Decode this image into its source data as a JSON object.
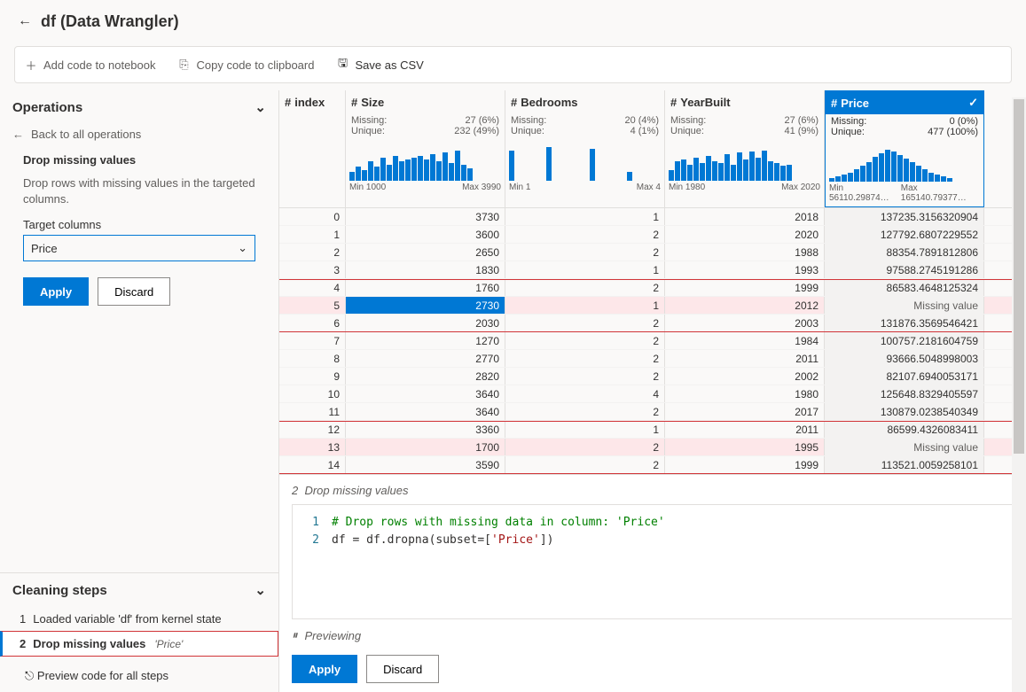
{
  "header": {
    "title": "df (Data Wrangler)"
  },
  "toolbar": {
    "add_code": "Add code to notebook",
    "copy_code": "Copy code to clipboard",
    "save_csv": "Save as CSV"
  },
  "operations": {
    "heading": "Operations",
    "back": "Back to all operations",
    "title": "Drop missing values",
    "desc": "Drop rows with missing values in the targeted columns.",
    "target_label": "Target columns",
    "target_value": "Price",
    "apply": "Apply",
    "discard": "Discard"
  },
  "steps": {
    "heading": "Cleaning steps",
    "items": [
      {
        "n": "1",
        "label": "Loaded variable 'df' from kernel state",
        "sub": ""
      },
      {
        "n": "2",
        "label": "Drop missing values",
        "sub": "'Price'"
      }
    ],
    "preview_all": "Preview code for all steps"
  },
  "columns": [
    {
      "key": "index",
      "label": "index",
      "missing": "",
      "unique": "",
      "min": "",
      "max": "",
      "bars": []
    },
    {
      "key": "size",
      "label": "Size",
      "missing": "27 (6%)",
      "unique": "232 (49%)",
      "min": "Min 1000",
      "max": "Max 3990",
      "bars": [
        10,
        16,
        12,
        22,
        16,
        26,
        18,
        28,
        22,
        24,
        26,
        28,
        24,
        30,
        22,
        32,
        20,
        34,
        18,
        14
      ]
    },
    {
      "key": "bed",
      "label": "Bedrooms",
      "missing": "20 (4%)",
      "unique": "4 (1%)",
      "min": "Min 1",
      "max": "Max 4",
      "bars": [
        34,
        0,
        0,
        0,
        0,
        0,
        38,
        0,
        0,
        0,
        0,
        0,
        0,
        36,
        0,
        0,
        0,
        0,
        0,
        10
      ]
    },
    {
      "key": "year",
      "label": "YearBuilt",
      "missing": "27 (6%)",
      "unique": "41 (9%)",
      "min": "Min 1980",
      "max": "Max 2020",
      "bars": [
        12,
        22,
        24,
        18,
        26,
        20,
        28,
        22,
        20,
        30,
        18,
        32,
        24,
        33,
        26,
        34,
        22,
        20,
        17,
        18
      ]
    },
    {
      "key": "price",
      "label": "Price",
      "missing": "0 (0%)",
      "unique": "477 (100%)",
      "min": "Min 56110.29874…",
      "max": "Max 165140.79377…",
      "bars": [
        4,
        6,
        8,
        10,
        14,
        18,
        22,
        28,
        32,
        36,
        34,
        30,
        26,
        22,
        18,
        14,
        10,
        8,
        6,
        4
      ]
    }
  ],
  "missing_l": "Missing:",
  "unique_l": "Unique:",
  "rows": [
    {
      "i": 0,
      "size": 3730,
      "bed": 1,
      "year": 2018,
      "price": "137235.3156320904",
      "hl": ""
    },
    {
      "i": 1,
      "size": 3600,
      "bed": 2,
      "year": 2020,
      "price": "127792.6807229552",
      "hl": ""
    },
    {
      "i": 2,
      "size": 2650,
      "bed": 2,
      "year": 1988,
      "price": "88354.7891812806",
      "hl": ""
    },
    {
      "i": 3,
      "size": 1830,
      "bed": 1,
      "year": 1993,
      "price": "97588.2745191286",
      "hl": ""
    },
    {
      "i": 4,
      "size": 1760,
      "bed": 2,
      "year": 1999,
      "price": "86583.4648125324",
      "hl": "red-top"
    },
    {
      "i": 5,
      "size": 2730,
      "bed": 1,
      "year": 2012,
      "price": "Missing value",
      "hl": "pink sel"
    },
    {
      "i": 6,
      "size": 2030,
      "bed": 2,
      "year": 2003,
      "price": "131876.3569546421",
      "hl": "red-bot"
    },
    {
      "i": 7,
      "size": 1270,
      "bed": 2,
      "year": 1984,
      "price": "100757.2181604759",
      "hl": ""
    },
    {
      "i": 8,
      "size": 2770,
      "bed": 2,
      "year": 2011,
      "price": "93666.5048998003",
      "hl": ""
    },
    {
      "i": 9,
      "size": 2820,
      "bed": 2,
      "year": 2002,
      "price": "82107.6940053171",
      "hl": ""
    },
    {
      "i": 10,
      "size": 3640,
      "bed": 4,
      "year": 1980,
      "price": "125648.8329405597",
      "hl": ""
    },
    {
      "i": 11,
      "size": 3640,
      "bed": 2,
      "year": 2017,
      "price": "130879.0238540349",
      "hl": ""
    },
    {
      "i": 12,
      "size": 3360,
      "bed": 1,
      "year": 2011,
      "price": "86599.4326083411",
      "hl": "red-top"
    },
    {
      "i": 13,
      "size": 1700,
      "bed": 2,
      "year": 1995,
      "price": "Missing value",
      "hl": "pink"
    },
    {
      "i": 14,
      "size": 3590,
      "bed": 2,
      "year": 1999,
      "price": "113521.0059258101",
      "hl": "red-bot"
    }
  ],
  "code": {
    "step_n": "2",
    "step_title": "Drop missing values",
    "comment": "# Drop rows with missing data in column: 'Price'",
    "line": "df = df.dropna(subset=['Price'])",
    "previewing": "Previewing",
    "apply": "Apply",
    "discard": "Discard"
  }
}
